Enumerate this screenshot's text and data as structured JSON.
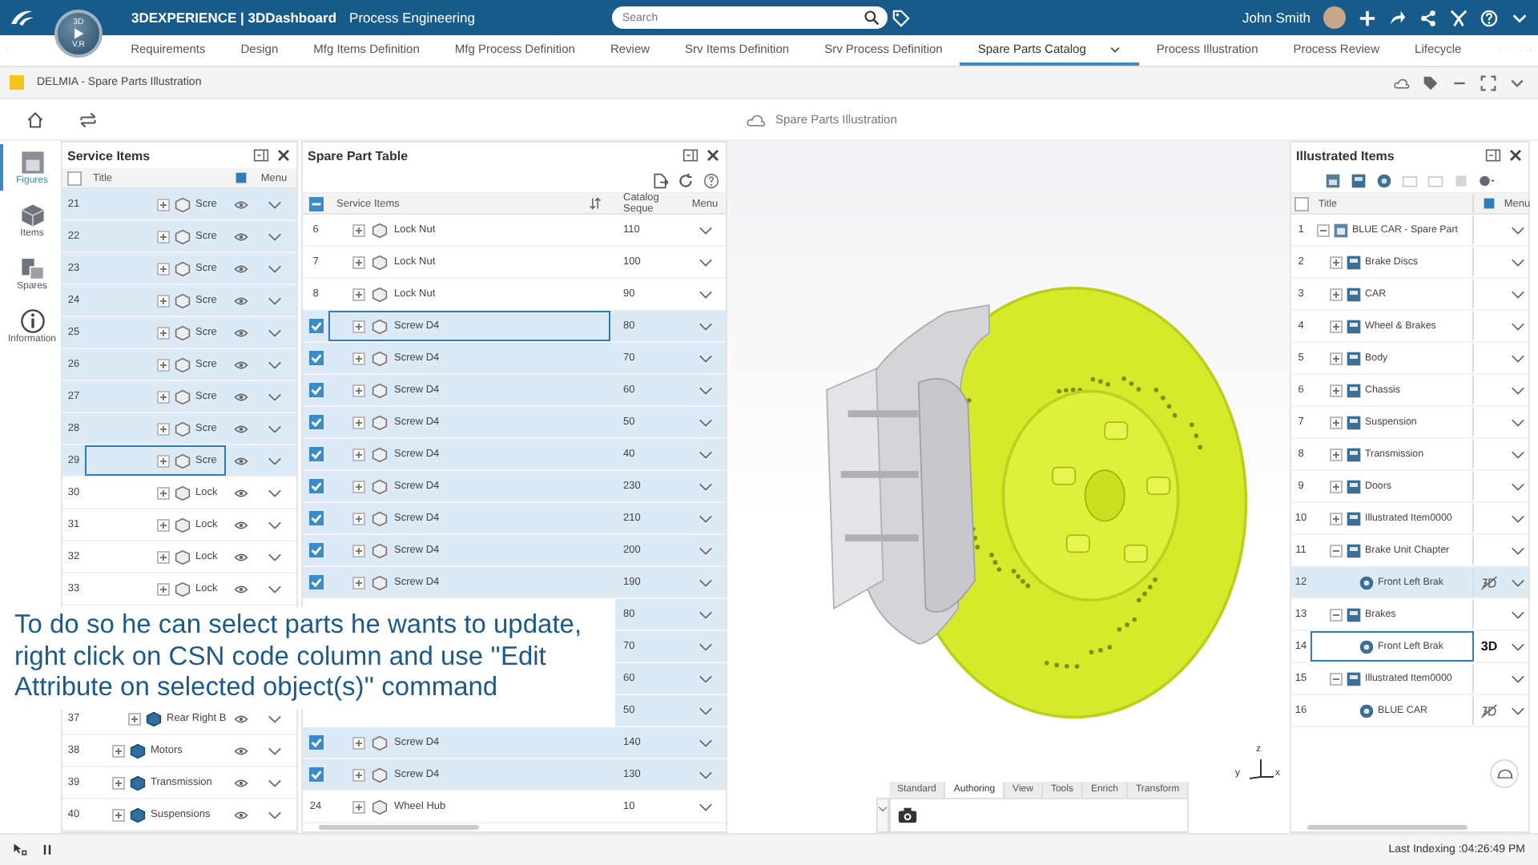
{
  "header": {
    "brand": "3DEXPERIENCE | 3DDashboard",
    "app": "Process Engineering",
    "compass_top": "3D",
    "compass_bottom": "V,R",
    "search": {
      "placeholder": "Search"
    },
    "user": "John Smith"
  },
  "tabs": [
    {
      "label": "Requirements",
      "selected": false
    },
    {
      "label": "Design",
      "selected": false
    },
    {
      "label": "Mfg Items Definition",
      "selected": false
    },
    {
      "label": "Mfg Process Definition",
      "selected": false
    },
    {
      "label": "Review",
      "selected": false
    },
    {
      "label": "Srv Items Definition",
      "selected": false
    },
    {
      "label": "Srv Process Definition",
      "selected": false
    },
    {
      "label": "Spare Parts Catalog",
      "selected": true
    },
    {
      "label": "Process Illustration",
      "selected": false
    },
    {
      "label": "Process Review",
      "selected": false
    },
    {
      "label": "Lifecycle",
      "selected": false
    }
  ],
  "app_bar": {
    "title": "DELMIA - Spare Parts Illustration"
  },
  "viewer_title": "Spare Parts Illustration",
  "sidebar": [
    {
      "label": "Figures",
      "kind": "figures",
      "selected": true
    },
    {
      "label": "Items",
      "kind": "items",
      "selected": false
    },
    {
      "label": "Spares",
      "kind": "spares",
      "selected": false
    },
    {
      "label": "Information",
      "kind": "information",
      "selected": false
    }
  ],
  "service_items": {
    "title": "Service Items",
    "select_all_checked": false,
    "columns": {
      "title": "Title",
      "menu": "Menu"
    },
    "rows_top": [
      {
        "num": "21",
        "title": "Scre",
        "kind": "part",
        "selected": true,
        "focused": false
      },
      {
        "num": "22",
        "title": "Scre",
        "kind": "part",
        "selected": true,
        "focused": false
      },
      {
        "num": "23",
        "title": "Scre",
        "kind": "part",
        "selected": true,
        "focused": false
      },
      {
        "num": "24",
        "title": "Scre",
        "kind": "part",
        "selected": true,
        "focused": false
      },
      {
        "num": "25",
        "title": "Scre",
        "kind": "part",
        "selected": true,
        "focused": false
      },
      {
        "num": "26",
        "title": "Scre",
        "kind": "part",
        "selected": true,
        "focused": false
      },
      {
        "num": "27",
        "title": "Scre",
        "kind": "part",
        "selected": true,
        "focused": false
      },
      {
        "num": "28",
        "title": "Scre",
        "kind": "part",
        "selected": true,
        "focused": false
      },
      {
        "num": "29",
        "title": "Scre",
        "kind": "part",
        "selected": true,
        "focused": true
      },
      {
        "num": "30",
        "title": "Lock",
        "kind": "part",
        "selected": false,
        "focused": false
      },
      {
        "num": "31",
        "title": "Lock",
        "kind": "part",
        "selected": false,
        "focused": false
      },
      {
        "num": "32",
        "title": "Lock",
        "kind": "part",
        "selected": false,
        "focused": false
      },
      {
        "num": "33",
        "title": "Lock",
        "kind": "part",
        "selected": false,
        "focused": false
      }
    ],
    "rows_bottom": [
      {
        "num": "37",
        "title": "Rear Right B",
        "kind": "subassembly",
        "selected": false,
        "focused": false
      },
      {
        "num": "38",
        "title": "Motors",
        "kind": "assembly",
        "selected": false,
        "focused": false
      },
      {
        "num": "39",
        "title": "Transmission",
        "kind": "assembly",
        "selected": false,
        "focused": false
      },
      {
        "num": "40",
        "title": "Suspensions",
        "kind": "assembly",
        "selected": false,
        "focused": false
      }
    ]
  },
  "spare_part_table": {
    "title": "Spare Part Table",
    "select_all_partial": true,
    "columns": {
      "name": "Service Items",
      "catalog": "Catalog Seque",
      "menu": "Menu"
    },
    "rows": [
      {
        "num": "6",
        "name": "Lock Nut",
        "catalog": "110",
        "selected": false,
        "focused": false
      },
      {
        "num": "7",
        "name": "Lock Nut",
        "catalog": "100",
        "selected": false,
        "focused": false
      },
      {
        "num": "8",
        "name": "Lock Nut",
        "catalog": "90",
        "selected": false,
        "focused": false
      },
      {
        "name": "Screw D4",
        "catalog": "80",
        "selected": true,
        "focused": true
      },
      {
        "name": "Screw D4",
        "catalog": "70",
        "selected": true,
        "focused": false
      },
      {
        "name": "Screw D4",
        "catalog": "60",
        "selected": true,
        "focused": false
      },
      {
        "name": "Screw D4",
        "catalog": "50",
        "selected": true,
        "focused": false
      },
      {
        "name": "Screw D4",
        "catalog": "40",
        "selected": true,
        "focused": false
      },
      {
        "name": "Screw D4",
        "catalog": "230",
        "selected": true,
        "focused": false
      },
      {
        "name": "Screw D4",
        "catalog": "210",
        "selected": true,
        "focused": false
      },
      {
        "name": "Screw D4",
        "catalog": "200",
        "selected": true,
        "focused": false
      },
      {
        "name": "Screw D4",
        "catalog": "190",
        "selected": true,
        "focused": false
      },
      {
        "catalog": "80",
        "selected": true
      },
      {
        "catalog": "70",
        "selected": true
      },
      {
        "catalog": "60",
        "selected": true
      },
      {
        "catalog": "50",
        "selected": true
      },
      {
        "name": "Screw D4",
        "catalog": "140",
        "selected": true,
        "focused": false
      },
      {
        "name": "Screw D4",
        "catalog": "130",
        "selected": true,
        "focused": false
      },
      {
        "num": "24",
        "name": "Wheel Hub",
        "catalog": "10",
        "selected": false,
        "focused": false
      }
    ]
  },
  "illustrated_items": {
    "title": "Illustrated Items",
    "select_all_checked": false,
    "columns": {
      "title": "Title",
      "menu": "Menu"
    },
    "tree": [
      {
        "num": "1",
        "title": "BLUE CAR - Spare Part",
        "kind": "root",
        "expanded": true,
        "selected": false,
        "focused": false,
        "children": [
          {
            "num": "2",
            "title": "Brake Discs",
            "kind": "group",
            "expanded": false,
            "selected": false,
            "focused": false
          },
          {
            "num": "3",
            "title": "CAR",
            "kind": "group",
            "expanded": false,
            "selected": false,
            "focused": false
          },
          {
            "num": "4",
            "title": "Wheel & Brakes",
            "kind": "group",
            "expanded": false,
            "selected": false,
            "focused": false
          },
          {
            "num": "5",
            "title": "Body",
            "kind": "group",
            "expanded": false,
            "selected": false,
            "focused": false
          },
          {
            "num": "6",
            "title": "Chassis",
            "kind": "group",
            "expanded": false,
            "selected": false,
            "focused": false
          },
          {
            "num": "7",
            "title": "Suspension",
            "kind": "group",
            "expanded": false,
            "selected": false,
            "focused": false
          },
          {
            "num": "8",
            "title": "Transmission",
            "kind": "group",
            "expanded": false,
            "selected": false,
            "focused": false
          },
          {
            "num": "9",
            "title": "Doors",
            "kind": "group",
            "expanded": false,
            "selected": false,
            "focused": false
          },
          {
            "num": "10",
            "title": "Illustrated Item0000",
            "kind": "group",
            "expanded": false,
            "selected": false,
            "focused": false
          },
          {
            "num": "11",
            "title": "Brake Unit Chapter",
            "kind": "group",
            "expanded": true,
            "selected": false,
            "focused": false,
            "children": [
              {
                "num": "12",
                "title": "Front Left Brak",
                "kind": "illustration",
                "hidden_3d": true,
                "selected": true,
                "focused": false
              }
            ]
          },
          {
            "num": "13",
            "title": "Brakes",
            "kind": "group",
            "expanded": true,
            "selected": false,
            "focused": false,
            "children": [
              {
                "num": "14",
                "title": "Front Left Brak",
                "kind": "illustration",
                "label_3d": "3D",
                "selected": false,
                "focused": true
              }
            ]
          },
          {
            "num": "15",
            "title": "Illustrated Item0000",
            "kind": "group",
            "expanded": true,
            "selected": false,
            "focused": false,
            "children": [
              {
                "num": "16",
                "title": "BLUE CAR",
                "kind": "illustration",
                "hidden_3d": true,
                "selected": false,
                "focused": false
              }
            ]
          }
        ]
      }
    ]
  },
  "viewer_tabs": [
    {
      "label": "Standard",
      "selected": false
    },
    {
      "label": "Authoring",
      "selected": true
    },
    {
      "label": "View",
      "selected": false
    },
    {
      "label": "Tools",
      "selected": false
    },
    {
      "label": "Enrich",
      "selected": false
    },
    {
      "label": "Transform",
      "selected": false
    }
  ],
  "axes": {
    "x": "x",
    "y": "y",
    "z": "z"
  },
  "caption": "To do so he can select parts he wants to update, right click on CSN code column and use ''Edit Attribute on selected object(s)'' command",
  "status_bar": {
    "text": "Last Indexing :04:26:49 PM"
  }
}
